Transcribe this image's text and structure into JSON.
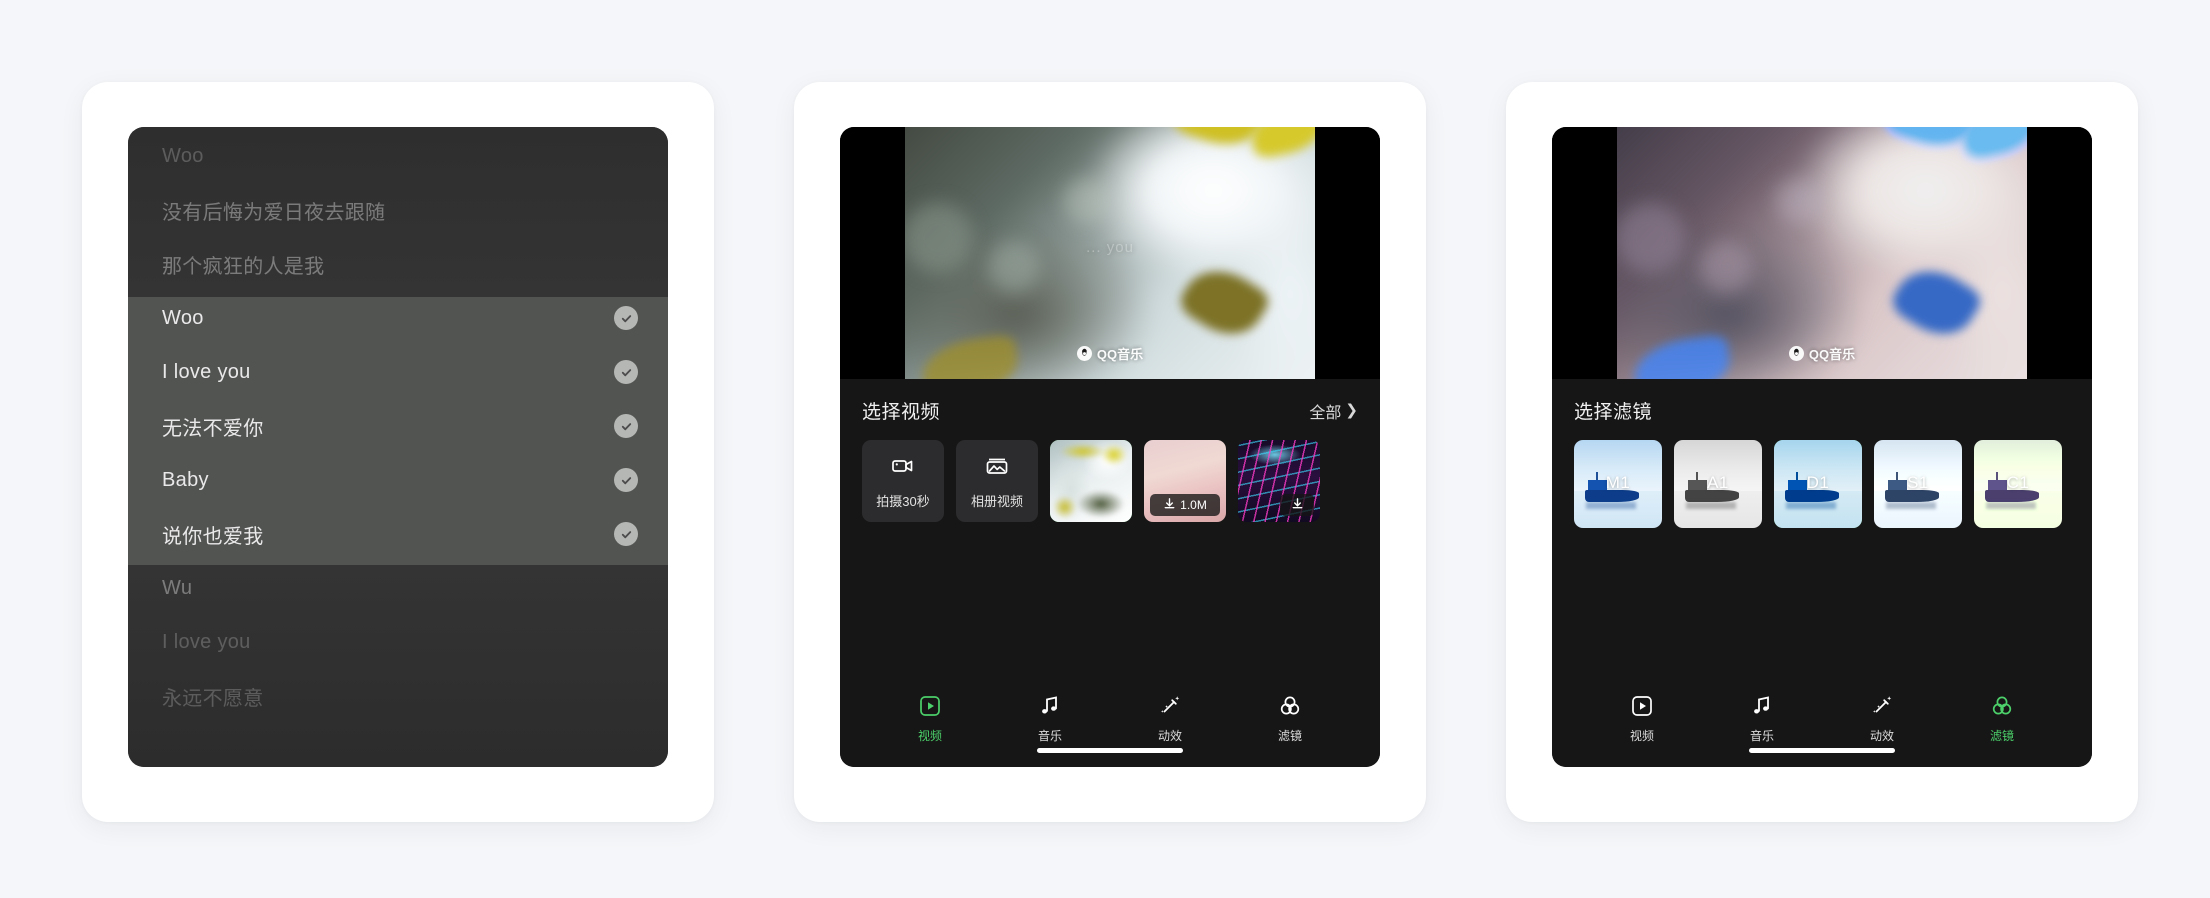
{
  "theme": {
    "page_background": "#f4f6f9",
    "card_background": "#ffffff",
    "accent_green": "#4cd06a",
    "sheet_background": "#161616",
    "tile_background": "#2c2c2e"
  },
  "panel_lyrics": {
    "name": "lyric-selection-panel",
    "rows": [
      {
        "text": "Woo",
        "state": "dimmer",
        "checked": false
      },
      {
        "text": "没有后悔为爱日夜去跟随",
        "state": "dim",
        "checked": false
      },
      {
        "text": "那个疯狂的人是我",
        "state": "dim",
        "checked": false
      },
      {
        "text": "Woo",
        "state": "sel",
        "checked": true
      },
      {
        "text": "I love you",
        "state": "sel",
        "checked": true
      },
      {
        "text": "无法不爱你",
        "state": "sel",
        "checked": true
      },
      {
        "text": "Baby",
        "state": "sel",
        "checked": true
      },
      {
        "text": "说你也爱我",
        "state": "sel",
        "checked": true
      },
      {
        "text": "Wu",
        "state": "dim",
        "checked": false
      },
      {
        "text": "I love you",
        "state": "dimmer",
        "checked": false
      },
      {
        "text": "永远不愿意",
        "state": "dimmer",
        "checked": false
      }
    ]
  },
  "panel_video": {
    "name": "select-video-panel",
    "preview": {
      "overlay_lyric": "...  you",
      "watermark_text": "QQ音乐",
      "watermark_icon": "qq-music-logo-icon"
    },
    "sheet": {
      "title": "选择视频",
      "all_label": "全部",
      "all_chevron": "chevron-right-icon"
    },
    "tiles": [
      {
        "kind": "action",
        "icon": "video-camera-icon",
        "label": "拍摄30秒",
        "selected": false,
        "badge": null
      },
      {
        "kind": "action",
        "icon": "photo-album-icon",
        "label": "相册视频",
        "selected": false,
        "badge": null
      },
      {
        "kind": "thumb",
        "art": "leaves",
        "label": "",
        "selected": true,
        "badge": null
      },
      {
        "kind": "thumb",
        "art": "pink",
        "label": "",
        "selected": false,
        "badge": {
          "icon": "download-icon",
          "text": "1.0M"
        }
      },
      {
        "kind": "thumb",
        "art": "neon",
        "label": "",
        "selected": false,
        "badge": {
          "icon": "download-icon",
          "text": ""
        }
      }
    ],
    "tabs": [
      {
        "label": "视频",
        "icon": "play-square-icon",
        "active": true
      },
      {
        "label": "音乐",
        "icon": "music-note-icon",
        "active": false
      },
      {
        "label": "动效",
        "icon": "magic-wand-icon",
        "active": false
      },
      {
        "label": "滤镜",
        "icon": "filter-circles-icon",
        "active": false
      }
    ]
  },
  "panel_filter": {
    "name": "select-filter-panel",
    "preview": {
      "watermark_text": "QQ音乐",
      "watermark_icon": "qq-music-logo-icon"
    },
    "sheet": {
      "title": "选择滤镜"
    },
    "filters": [
      {
        "label": "M1",
        "fx": "fx-m1",
        "selected": false
      },
      {
        "label": "A1",
        "fx": "fx-a1",
        "selected": false
      },
      {
        "label": "D1",
        "fx": "fx-d1",
        "selected": true
      },
      {
        "label": "S1",
        "fx": "fx-s1",
        "selected": false
      },
      {
        "label": "C1",
        "fx": "fx-c1",
        "selected": false
      }
    ],
    "tabs": [
      {
        "label": "视频",
        "icon": "play-square-icon",
        "active": false
      },
      {
        "label": "音乐",
        "icon": "music-note-icon",
        "active": false
      },
      {
        "label": "动效",
        "icon": "magic-wand-icon",
        "active": false
      },
      {
        "label": "滤镜",
        "icon": "filter-circles-icon",
        "active": true
      }
    ]
  }
}
